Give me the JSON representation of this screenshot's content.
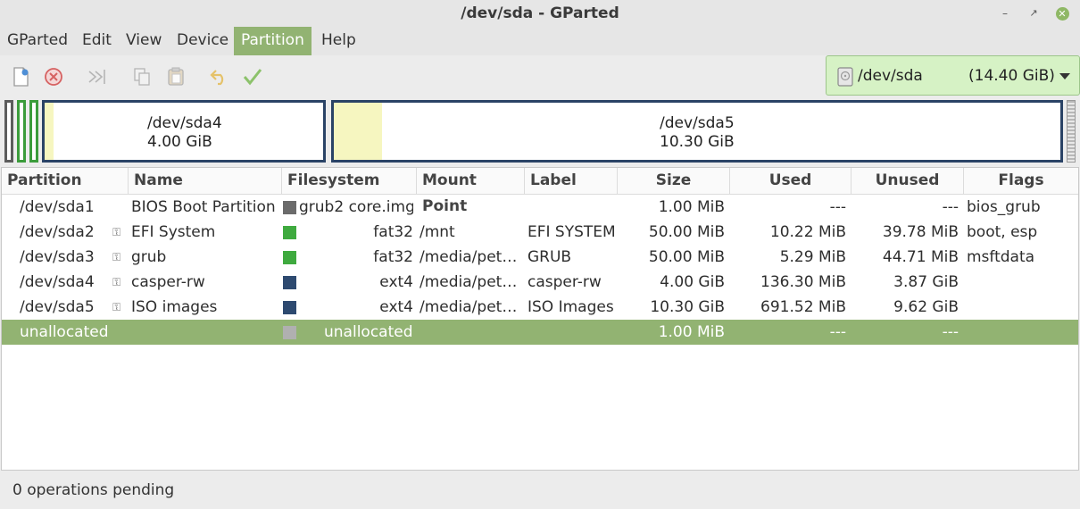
{
  "window": {
    "title": "/dev/sda - GParted"
  },
  "menubar": {
    "items": [
      {
        "label": "GParted"
      },
      {
        "label": "Edit"
      },
      {
        "label": "View"
      },
      {
        "label": "Device"
      },
      {
        "label": "Partition"
      },
      {
        "label": "Help"
      }
    ],
    "active": "Partition"
  },
  "toolbar": {
    "buttons": [
      "new-partition-icon",
      "delete-icon",
      "resize-move-icon",
      "copy-icon",
      "paste-icon",
      "undo-icon",
      "apply-icon"
    ],
    "device": {
      "name": "/dev/sda",
      "size": "(14.40 GiB)"
    }
  },
  "diskmap": {
    "sda4": {
      "name": "/dev/sda4",
      "size": "4.00 GiB",
      "used_fraction": 0.033
    },
    "sda5": {
      "name": "/dev/sda5",
      "size": "10.30 GiB",
      "used_fraction": 0.066
    }
  },
  "table": {
    "headers": [
      "Partition",
      "Name",
      "Filesystem",
      "Mount Point",
      "Label",
      "Size",
      "Used",
      "Unused",
      "Flags"
    ],
    "rows": [
      {
        "partition": "/dev/sda1",
        "name": "BIOS Boot Partition",
        "fs": "grub2 core.img",
        "mount": "",
        "label": "",
        "size": "1.00 MiB",
        "used": "---",
        "unused": "---",
        "flags": "bios_grub",
        "mounted": false,
        "fs_color": "#6b6b6b"
      },
      {
        "partition": "/dev/sda2",
        "name": "EFI System",
        "fs": "fat32",
        "mount": "/mnt",
        "label": "EFI SYSTEM",
        "size": "50.00 MiB",
        "used": "10.22 MiB",
        "unused": "39.78 MiB",
        "flags": "boot, esp",
        "mounted": true,
        "fs_color": "#3faa3f"
      },
      {
        "partition": "/dev/sda3",
        "name": "grub",
        "fs": "fat32",
        "mount": "/media/pet…",
        "label": "GRUB",
        "size": "50.00 MiB",
        "used": "5.29 MiB",
        "unused": "44.71 MiB",
        "flags": "msftdata",
        "mounted": true,
        "fs_color": "#3faa3f"
      },
      {
        "partition": "/dev/sda4",
        "name": "casper-rw",
        "fs": "ext4",
        "mount": "/media/pet…",
        "label": "casper-rw",
        "size": "4.00 GiB",
        "used": "136.30 MiB",
        "unused": "3.87 GiB",
        "flags": "",
        "mounted": true,
        "fs_color": "#2e4a70"
      },
      {
        "partition": "/dev/sda5",
        "name": "ISO images",
        "fs": "ext4",
        "mount": "/media/pet…",
        "label": "ISO Images",
        "size": "10.30 GiB",
        "used": "691.52 MiB",
        "unused": "9.62 GiB",
        "flags": "",
        "mounted": true,
        "fs_color": "#2e4a70"
      },
      {
        "partition": "unallocated",
        "name": "",
        "fs": "unallocated",
        "mount": "",
        "label": "",
        "size": "1.00 MiB",
        "used": "---",
        "unused": "---",
        "flags": "",
        "mounted": false,
        "fs_color": "#b0b0b0"
      }
    ],
    "selected_row": 5
  },
  "status": {
    "text": "0 operations pending"
  },
  "colors": {
    "accent": "#92b372",
    "device_combo_bg": "#d6f2c5",
    "ext4": "#2e4a70",
    "fat32": "#3faa3f",
    "grub": "#6b6b6b",
    "unallocated": "#b0b0b0"
  }
}
